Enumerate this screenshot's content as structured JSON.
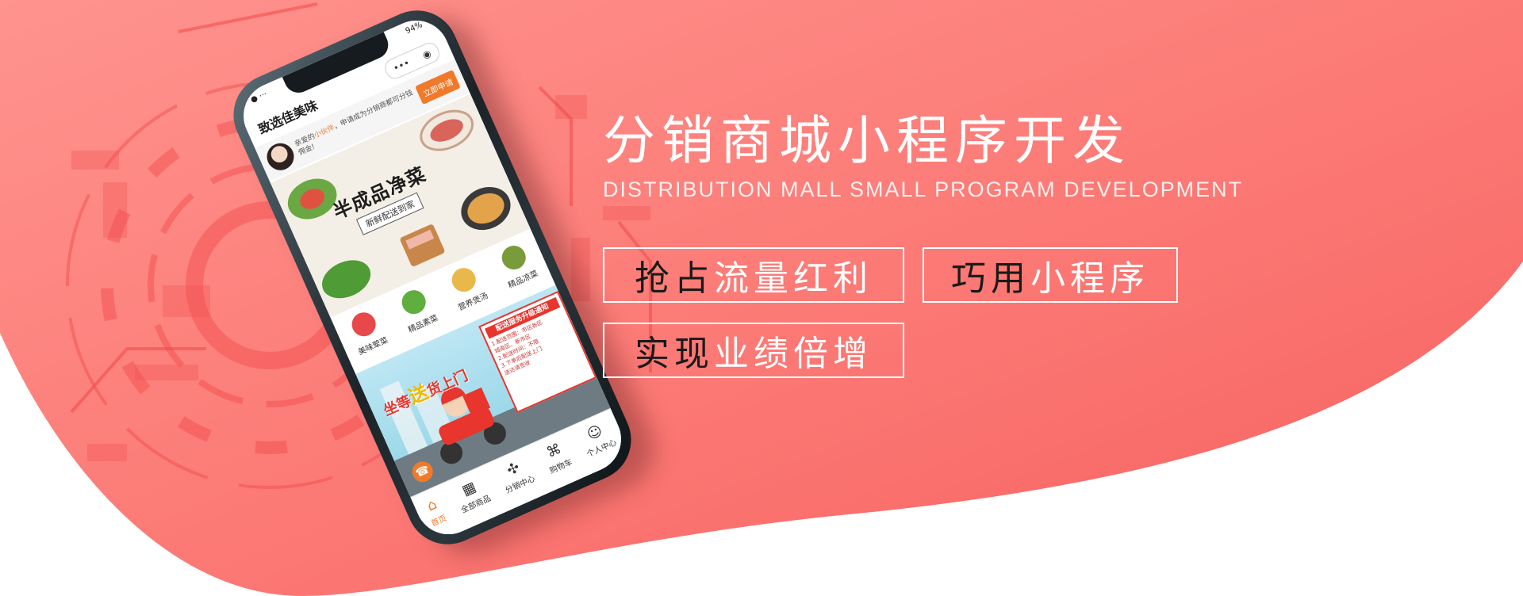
{
  "colors": {
    "bg_coral_light": "#ff8a86",
    "bg_coral_dark": "#f9605e",
    "white": "#ffffff",
    "accent_orange": "#f07a2a",
    "text_dark": "#1a1a1a"
  },
  "phone": {
    "status": {
      "left": "● ···",
      "right": "94%"
    },
    "nav_title": "致选佳美味",
    "capsule_icons": [
      "more-dots-icon",
      "record-icon"
    ],
    "capsule_more": "•••",
    "capsule_close": "◉",
    "promo": {
      "text_prefix": "亲爱的",
      "text_highlight": "小伙伴",
      "text_suffix": "，申请成为分销商都可分钱佣金!",
      "apply_label": "立即申请"
    },
    "hero": {
      "title": "半成品净菜",
      "subtitle": "新鲜配送到家"
    },
    "categories": [
      {
        "label": "美味荤菜",
        "color": "#e8484a"
      },
      {
        "label": "精品素菜",
        "color": "#5fae3e"
      },
      {
        "label": "营养煲汤",
        "color": "#e8b94a"
      },
      {
        "label": "精品凉菜",
        "color": "#7a9b3a"
      }
    ],
    "delivery": {
      "title_a": "坐等",
      "title_big": "送",
      "title_b": "货上门",
      "panel_title": "配送服务升级通知",
      "panel_lines": [
        "1.配送范围：市区各区",
        "城南区、新市区",
        "2.配送时间：不限",
        "3.下单后配送上门",
        "送达请签收"
      ]
    },
    "tabs": [
      {
        "label": "首页",
        "icon": "⌂",
        "icon_name": "home-icon",
        "active": true
      },
      {
        "label": "全部商品",
        "icon": "▦",
        "icon_name": "grid-icon",
        "active": false
      },
      {
        "label": "分销中心",
        "icon": "✣",
        "icon_name": "share-network-icon",
        "active": false
      },
      {
        "label": "购物车",
        "icon": "⌘",
        "icon_name": "cart-icon",
        "active": false
      },
      {
        "label": "个人中心",
        "icon": "☺",
        "icon_name": "user-icon",
        "active": false
      }
    ],
    "float_icon": "☎"
  },
  "headline": "分销商城小程序开发",
  "subline": "DISTRIBUTION MALL SMALL PROGRAM DEVELOPMENT",
  "tags": {
    "tag1": {
      "dark": "抢占",
      "light": "流量红利"
    },
    "tag2": {
      "dark": "巧用",
      "light": "小程序"
    },
    "tag3": {
      "dark": "实现",
      "light": "业绩倍增"
    }
  }
}
